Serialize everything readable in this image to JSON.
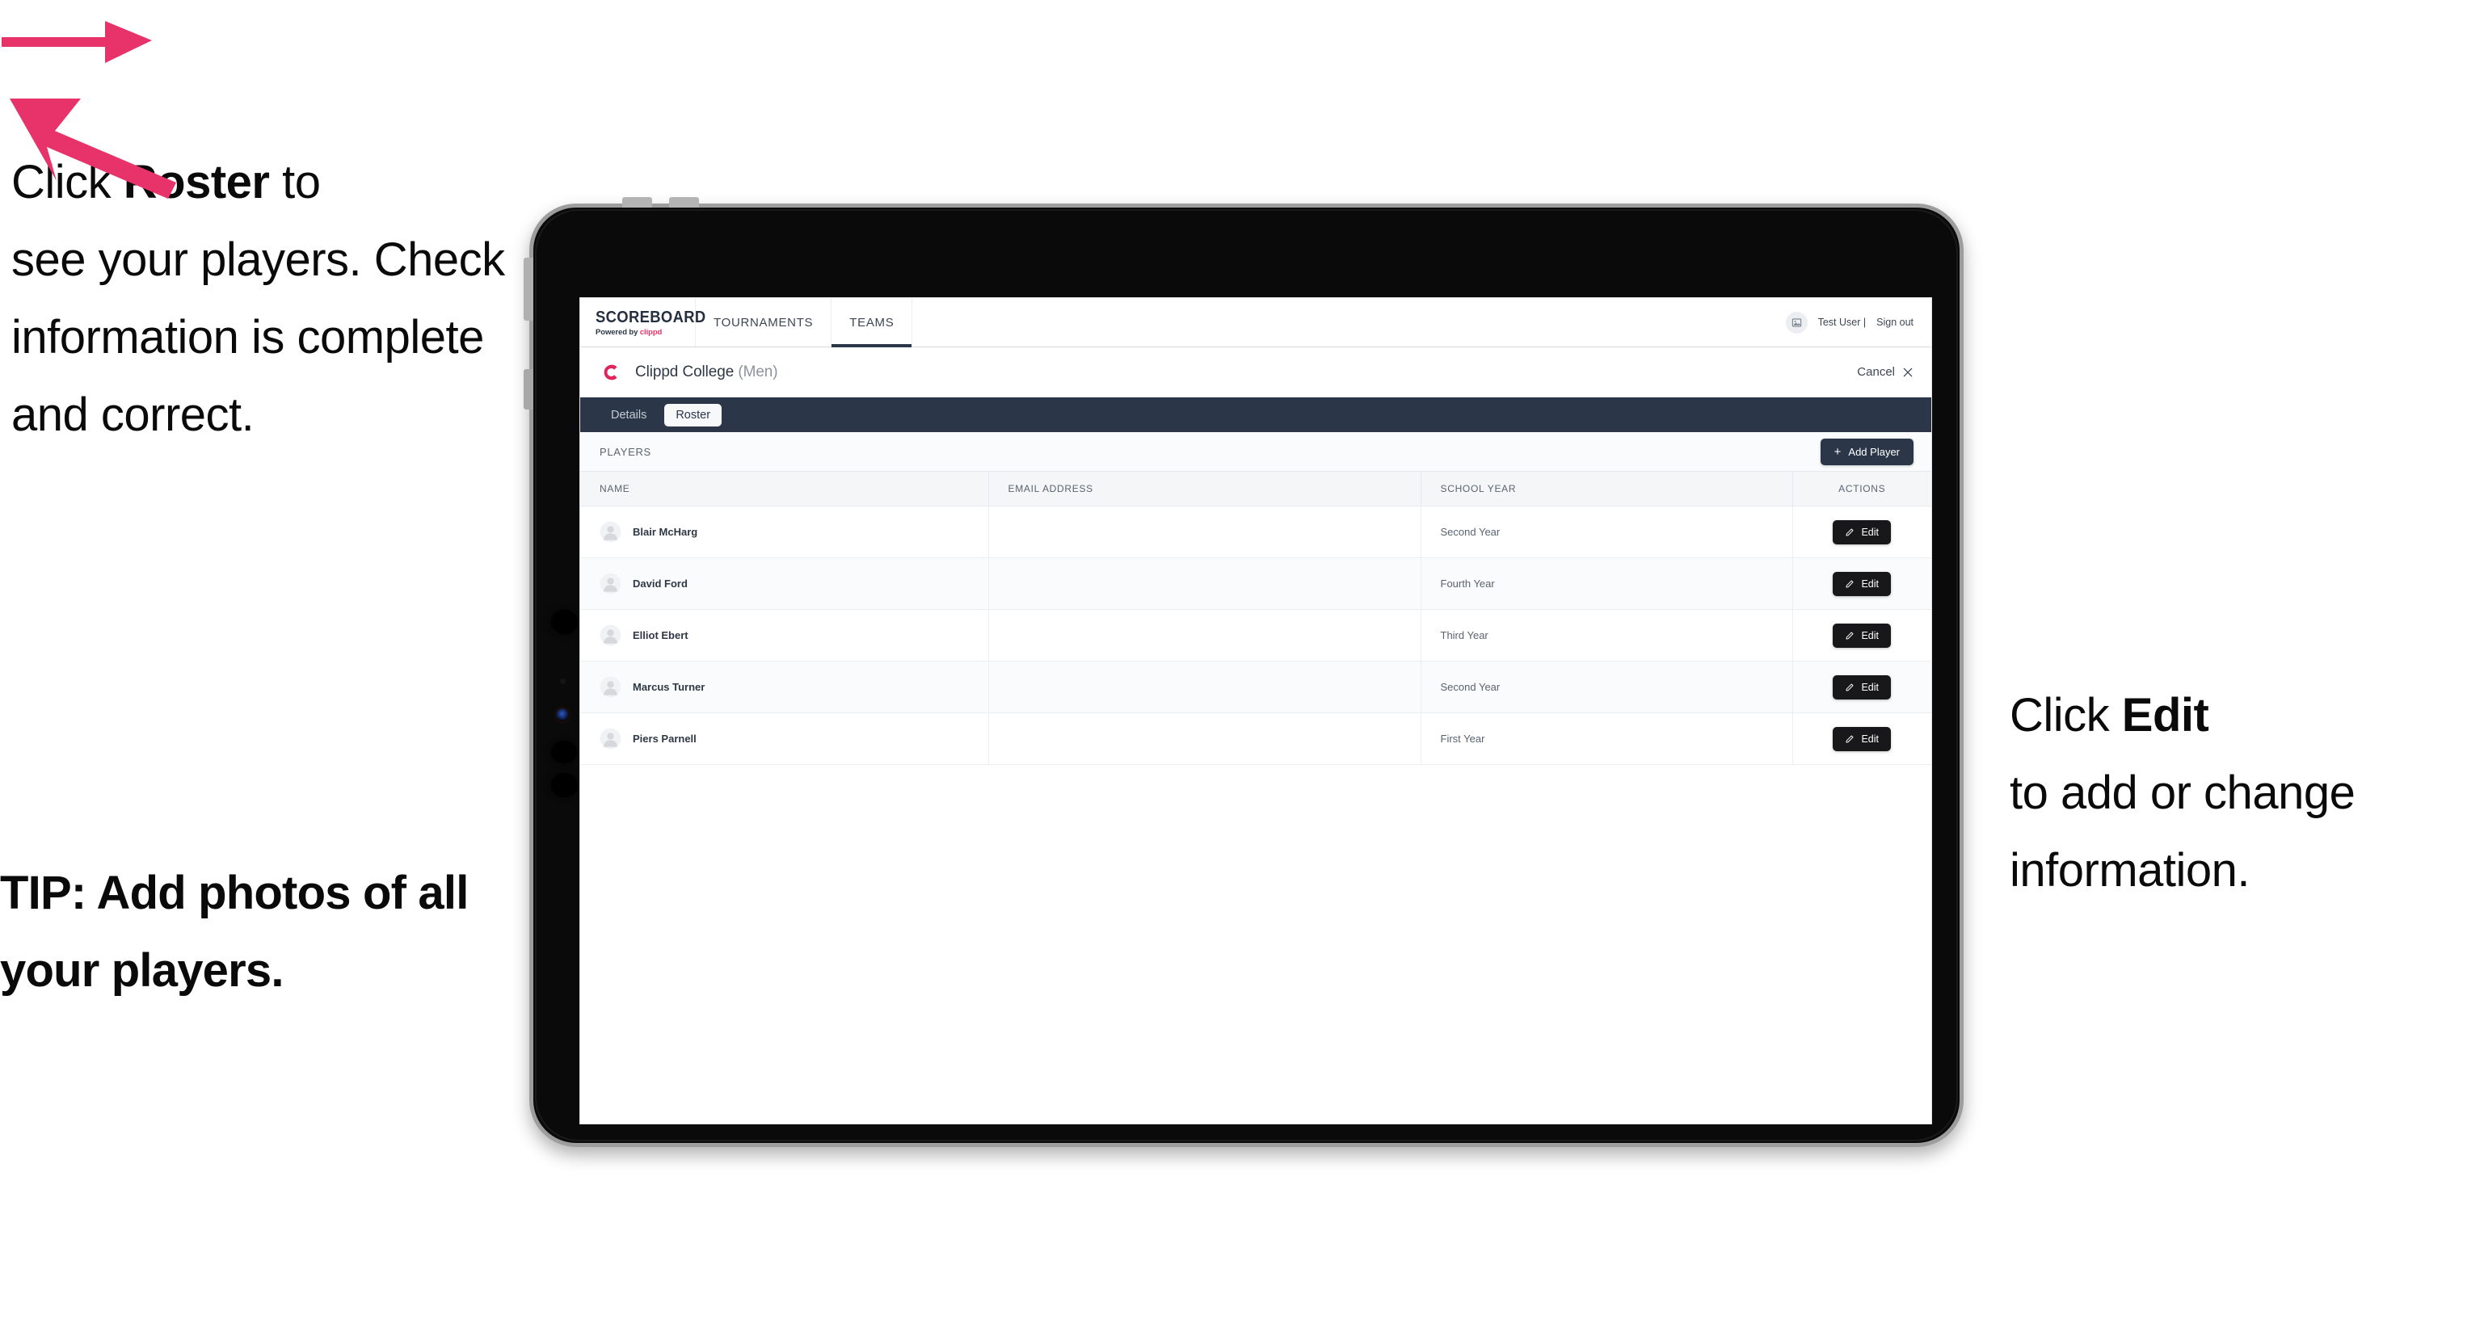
{
  "annotations": {
    "left": {
      "line1_pre": "Click ",
      "line1_bold": "Roster",
      "line1_post": " to",
      "rest": "see your players. Check information is complete and correct."
    },
    "tip": "TIP: Add photos of all your players.",
    "right": {
      "line1_pre": "Click ",
      "line1_bold": "Edit",
      "rest": "to add or change information."
    },
    "arrow_color": "#e8336a"
  },
  "app": {
    "brand": {
      "name": "SCOREBOARD",
      "powered_by_prefix": "Powered by ",
      "powered_by_brand": "clippd"
    },
    "nav_tabs": [
      {
        "label": "TOURNAMENTS",
        "active": false
      },
      {
        "label": "TEAMS",
        "active": true
      }
    ],
    "user": {
      "name": "Test User |",
      "signout": "Sign out",
      "avatar_icon": "image-placeholder-icon"
    },
    "team_header": {
      "logo_letter": "C",
      "logo_color": "#e0245e",
      "name": "Clippd College",
      "name_suffix": "(Men)",
      "cancel_label": "Cancel",
      "cancel_icon": "close-icon"
    },
    "tab_strip": [
      {
        "label": "Details",
        "active": false
      },
      {
        "label": "Roster",
        "active": true
      }
    ],
    "toolbar": {
      "section_label": "PLAYERS",
      "add_player_label": "Add Player",
      "add_player_icon": "plus-icon"
    },
    "table": {
      "columns": [
        "NAME",
        "EMAIL ADDRESS",
        "SCHOOL YEAR",
        "ACTIONS"
      ],
      "rows": [
        {
          "name": "Blair McHarg",
          "email": "",
          "school_year": "Second Year",
          "action_label": "Edit"
        },
        {
          "name": "David Ford",
          "email": "",
          "school_year": "Fourth Year",
          "action_label": "Edit"
        },
        {
          "name": "Elliot Ebert",
          "email": "",
          "school_year": "Third Year",
          "action_label": "Edit"
        },
        {
          "name": "Marcus Turner",
          "email": "",
          "school_year": "Second Year",
          "action_label": "Edit"
        },
        {
          "name": "Piers Parnell",
          "email": "",
          "school_year": "First Year",
          "action_label": "Edit"
        }
      ]
    }
  }
}
